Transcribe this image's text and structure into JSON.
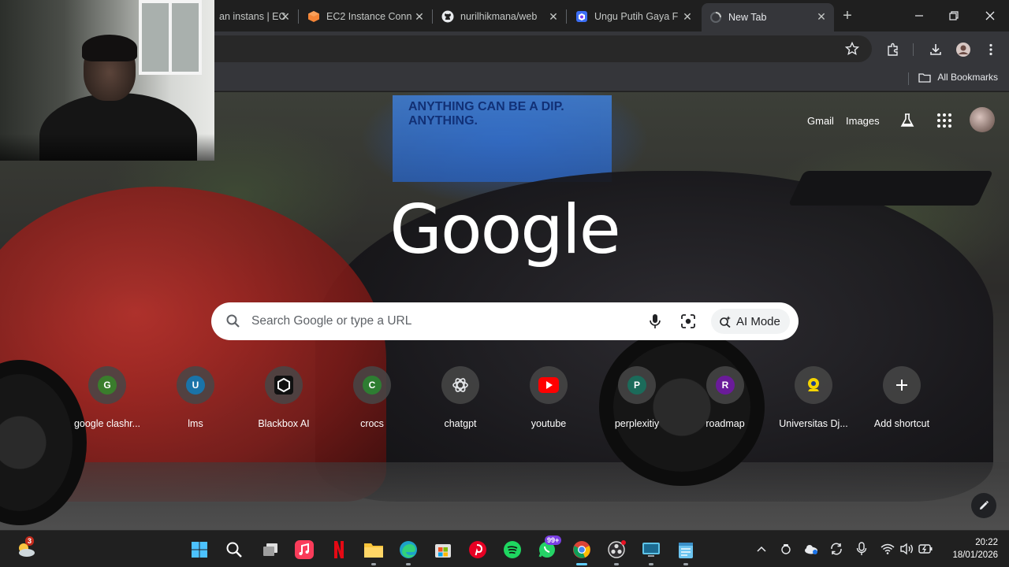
{
  "browser": {
    "tabs": [
      {
        "title": "an instans | EC",
        "favicon": "aws-icon"
      },
      {
        "title": "EC2 Instance Conn",
        "favicon": "aws-ec2-icon"
      },
      {
        "title": "nurilhikmana/web",
        "favicon": "github-icon"
      },
      {
        "title": "Ungu Putih Gaya F",
        "favicon": "canva-icon"
      },
      {
        "title": "New Tab",
        "favicon": "loading-icon"
      }
    ],
    "close_glyph": "✕",
    "new_tab_glyph": "+",
    "bookmarks": {
      "all_label": "All Bookmarks"
    }
  },
  "ntp": {
    "links": {
      "gmail": "Gmail",
      "images": "Images"
    },
    "logo": "Google",
    "search": {
      "placeholder": "Search Google or type a URL",
      "ai_mode_label": "AI Mode"
    },
    "shortcuts": [
      {
        "letter": "G",
        "label": "google clashr...",
        "color": "#3a7d2c"
      },
      {
        "letter": "U",
        "label": "lms",
        "color": "#1a73a8"
      },
      {
        "letter": "",
        "label": "Blackbox AI",
        "color": "#111111"
      },
      {
        "letter": "C",
        "label": "crocs",
        "color": "#2e7d32"
      },
      {
        "letter": "",
        "label": "chatgpt",
        "color": "#ffffff"
      },
      {
        "letter": "",
        "label": "youtube",
        "color": "#ff0000"
      },
      {
        "letter": "P",
        "label": "perplexitiy",
        "color": "#1b6b5a"
      },
      {
        "letter": "R",
        "label": "roadmap",
        "color": "#6a1b9a"
      },
      {
        "letter": "",
        "label": "Universitas Dj...",
        "color": "#f4d400"
      },
      {
        "letter": "+",
        "label": "Add shortcut",
        "color": "#444444"
      }
    ],
    "billboard_text": "ANYTHING CAN BE A DIP. ANYTHING."
  },
  "taskbar": {
    "widgets_badge": "3",
    "whatsapp_badge": "99+",
    "clock": {
      "time": "20:22",
      "date": "18/01/2026"
    }
  }
}
